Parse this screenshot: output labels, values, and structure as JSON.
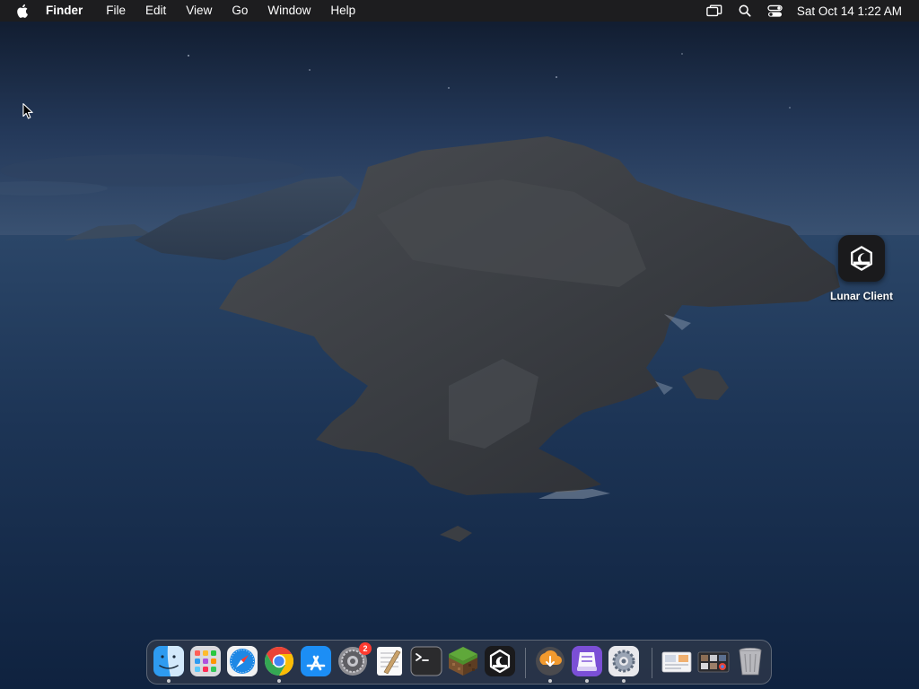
{
  "menubar": {
    "apple_icon": "apple-logo-icon",
    "app_name": "Finder",
    "menus": [
      "File",
      "Edit",
      "View",
      "Go",
      "Window"
    ],
    "help": "Help",
    "status_icons": [
      "screen-mirroring-icon",
      "spotlight-search-icon",
      "control-center-icon"
    ],
    "clock": "Sat Oct 14  1:22 AM"
  },
  "desktop": {
    "icons": [
      {
        "label": "Lunar Client",
        "icon": "lunar-client-icon"
      }
    ]
  },
  "dock": {
    "apps": [
      {
        "name": "Finder",
        "icon": "finder-icon",
        "running": true
      },
      {
        "name": "Launchpad",
        "icon": "launchpad-icon",
        "running": false
      },
      {
        "name": "Safari",
        "icon": "safari-icon",
        "running": false
      },
      {
        "name": "Google Chrome",
        "icon": "chrome-icon",
        "running": true
      },
      {
        "name": "App Store",
        "icon": "app-store-icon",
        "running": false
      },
      {
        "name": "System Settings",
        "icon": "system-settings-icon",
        "running": false,
        "badge": "2"
      },
      {
        "name": "TextEdit",
        "icon": "textedit-icon",
        "running": false
      },
      {
        "name": "Terminal",
        "icon": "terminal-icon",
        "running": false
      },
      {
        "name": "Minecraft",
        "icon": "minecraft-icon",
        "running": false
      },
      {
        "name": "Lunar Client",
        "icon": "lunar-client-icon",
        "running": false
      }
    ],
    "recent_apps": [
      {
        "name": "Downloader",
        "icon": "download-app-icon",
        "running": true
      },
      {
        "name": "Installer",
        "icon": "installer-icon",
        "running": true
      },
      {
        "name": "Preferences",
        "icon": "preferences-gear-icon",
        "running": true
      }
    ],
    "folders": [
      {
        "name": "Documents stack",
        "icon": "documents-stack-icon"
      },
      {
        "name": "Downloads stack",
        "icon": "downloads-stack-icon"
      }
    ],
    "trash": {
      "name": "Trash",
      "icon": "trash-icon"
    }
  },
  "colors": {
    "menubar_bg": "#1d1d1f",
    "badge": "#ff3b30"
  }
}
